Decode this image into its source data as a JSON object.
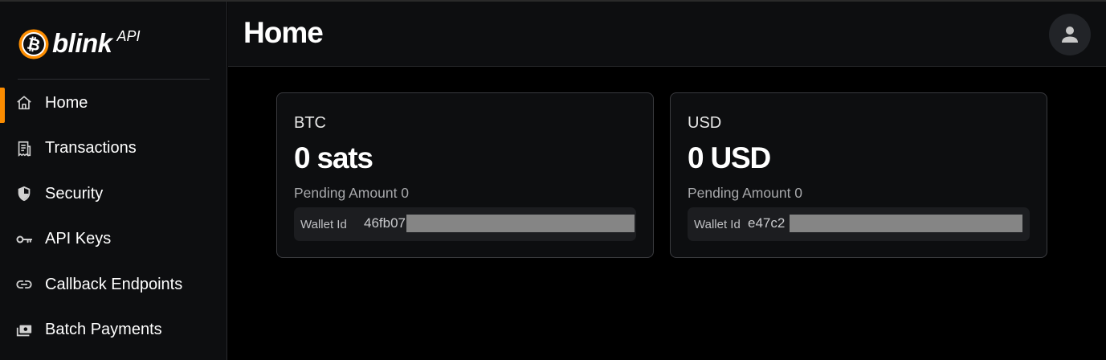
{
  "brand": {
    "name": "blink",
    "suffix": "API",
    "accent_color": "#fb8c00"
  },
  "sidebar": {
    "items": [
      {
        "label": "Home",
        "icon": "home-icon",
        "active": true
      },
      {
        "label": "Transactions",
        "icon": "receipt-icon",
        "active": false
      },
      {
        "label": "Security",
        "icon": "shield-icon",
        "active": false
      },
      {
        "label": "API Keys",
        "icon": "key-icon",
        "active": false
      },
      {
        "label": "Callback Endpoints",
        "icon": "link-icon",
        "active": false
      },
      {
        "label": "Batch Payments",
        "icon": "payments-icon",
        "active": false
      }
    ]
  },
  "header": {
    "title": "Home",
    "avatar_icon": "user-icon"
  },
  "wallets": [
    {
      "currency": "BTC",
      "balance": "0 sats",
      "pending": "Pending Amount 0",
      "wallet_label": "Wallet Id",
      "wallet_id_visible": "46fb07"
    },
    {
      "currency": "USD",
      "balance": "0 USD",
      "pending": "Pending Amount 0",
      "wallet_label": "Wallet Id",
      "wallet_id_visible": "e47c2"
    }
  ]
}
